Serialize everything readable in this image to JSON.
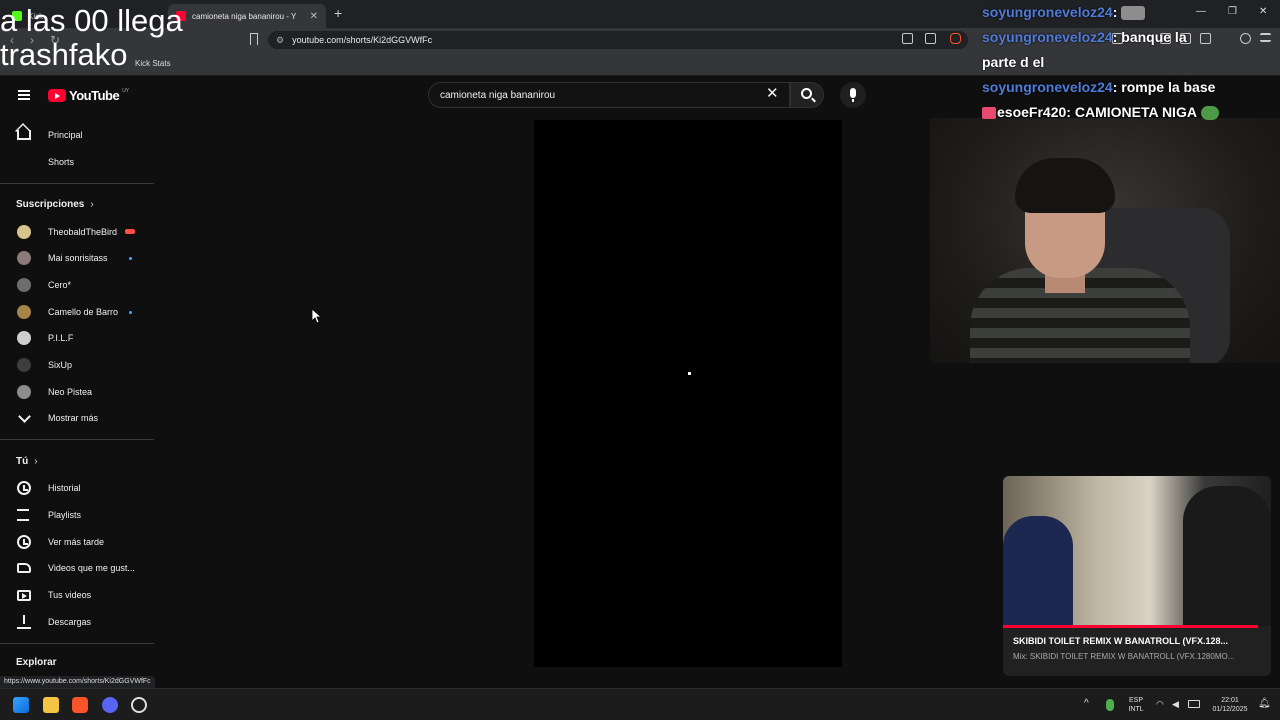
{
  "browser": {
    "tabs": [
      {
        "title": "Kick"
      },
      {
        "title": "camioneta niga bananirou - You"
      }
    ],
    "url": "youtube.com/shorts/Ki2dGGVWfFc",
    "bookmarks": [
      "Kick Stats"
    ],
    "status_url": "https://www.youtube.com/shorts/Ki2dGGVWfFc"
  },
  "overlay": {
    "text": "a las 00 llega\ntrashfako"
  },
  "chat": [
    {
      "user": "soyungroneveloz24",
      "message": ""
    },
    {
      "user": "soyungroneveloz24",
      "message": "banque la"
    },
    {
      "user": "",
      "message": "parte d el"
    },
    {
      "user": "soyungroneveloz24",
      "message": "rompe la base"
    },
    {
      "user": "esoeFr420",
      "message": "CAMIONETA NIGA"
    }
  ],
  "youtube": {
    "logo_text": "YouTube",
    "logo_country": "UY",
    "search_value": "camioneta niga bananirou",
    "nav_primary": [
      {
        "label": "Principal",
        "icon": "home-icon"
      },
      {
        "label": "Shorts",
        "icon": "shorts-icon"
      }
    ],
    "subscriptions_title": "Suscripciones",
    "subscriptions": [
      {
        "name": "TheobaldTheBird",
        "indicator": "live"
      },
      {
        "name": "Mai sonrisitass",
        "indicator": "dot"
      },
      {
        "name": "Cero*",
        "indicator": ""
      },
      {
        "name": "Camello de Barro",
        "indicator": "dot"
      },
      {
        "name": "P.I.L.F",
        "indicator": ""
      },
      {
        "name": "SixUp",
        "indicator": ""
      },
      {
        "name": "Neo Pistea",
        "indicator": ""
      }
    ],
    "show_more": "Mostrar más",
    "you_title": "Tú",
    "you_items": [
      {
        "label": "Historial",
        "icon": "history-icon"
      },
      {
        "label": "Playlists",
        "icon": "playlist-icon"
      },
      {
        "label": "Ver más tarde",
        "icon": "clock-icon"
      },
      {
        "label": "Videos que me gust...",
        "icon": "thumbs-up-icon"
      },
      {
        "label": "Tus videos",
        "icon": "video-icon"
      },
      {
        "label": "Descargas",
        "icon": "download-icon"
      }
    ],
    "explore_title": "Explorar"
  },
  "mini_player": {
    "title": "SKIBIDI TOILET REMIX W BANATROLL (VFX.128...",
    "subtitle": "Mix: SKIBIDI TOILET REMIX W BANATROLL (VFX.1280MO...",
    "progress": 0.95
  },
  "taskbar": {
    "lang_top": "ESP",
    "lang_bottom": "INTL",
    "time": "22:01",
    "date": "01/12/2025"
  },
  "colors": {
    "accent": "#ff0033",
    "chat_user": "#4f7bd9",
    "background": "#0f0f0f"
  }
}
